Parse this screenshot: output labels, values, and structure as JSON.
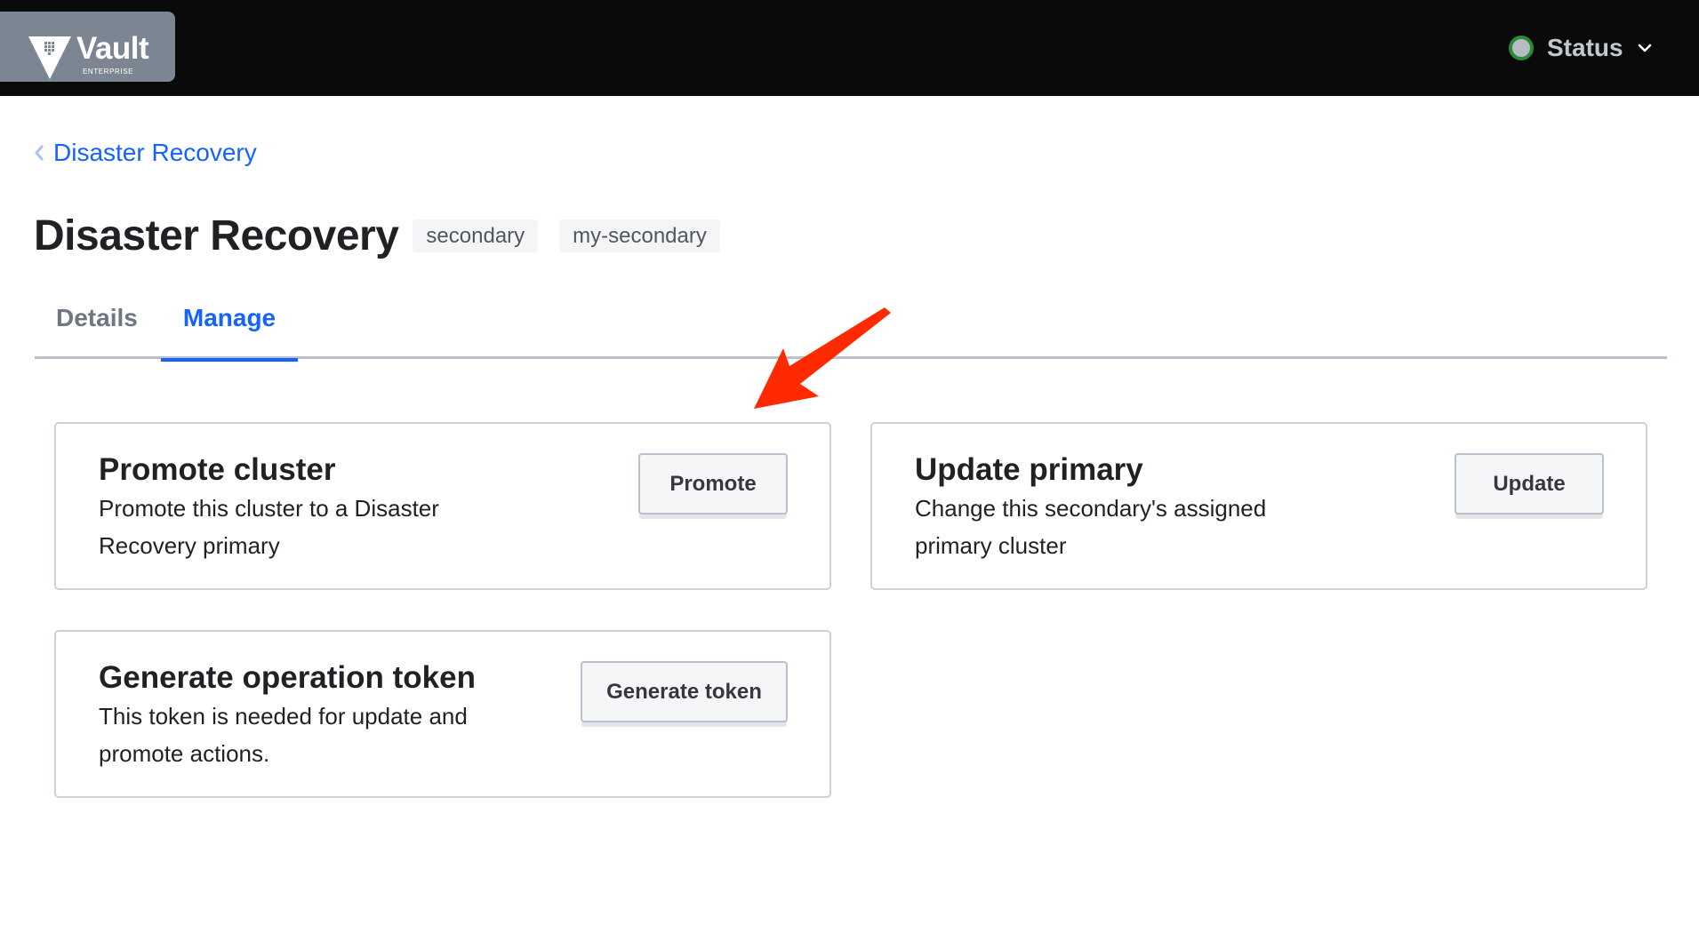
{
  "topbar": {
    "logo": {
      "name": "Vault",
      "edition": "ENTERPRISE",
      "icon": "vault-triangle-icon"
    },
    "status": {
      "label": "Status",
      "indicator_color": "#2a8a35",
      "icon": "chevron-down-icon"
    }
  },
  "breadcrumb": {
    "label": "Disaster Recovery",
    "icon": "chevron-left-icon"
  },
  "header": {
    "title": "Disaster Recovery",
    "badges": [
      "secondary",
      "my-secondary"
    ]
  },
  "tabs": [
    {
      "label": "Details",
      "active": false
    },
    {
      "label": "Manage",
      "active": true
    }
  ],
  "cards": [
    {
      "title": "Promote cluster",
      "description": "Promote this cluster to a Disaster Recovery primary",
      "button": "Promote"
    },
    {
      "title": "Update primary",
      "description": "Change this secondary's assigned primary cluster",
      "button": "Update"
    },
    {
      "title": "Generate operation token",
      "description": "This token is needed for update and promote actions.",
      "button": "Generate token"
    }
  ],
  "annotation": {
    "type": "arrow",
    "color": "#ff2a00",
    "points_to": "Promote cluster card"
  },
  "colors": {
    "accent": "#1563ff",
    "topbar": "#0a0a0a",
    "logo_bg": "#7c8592"
  }
}
